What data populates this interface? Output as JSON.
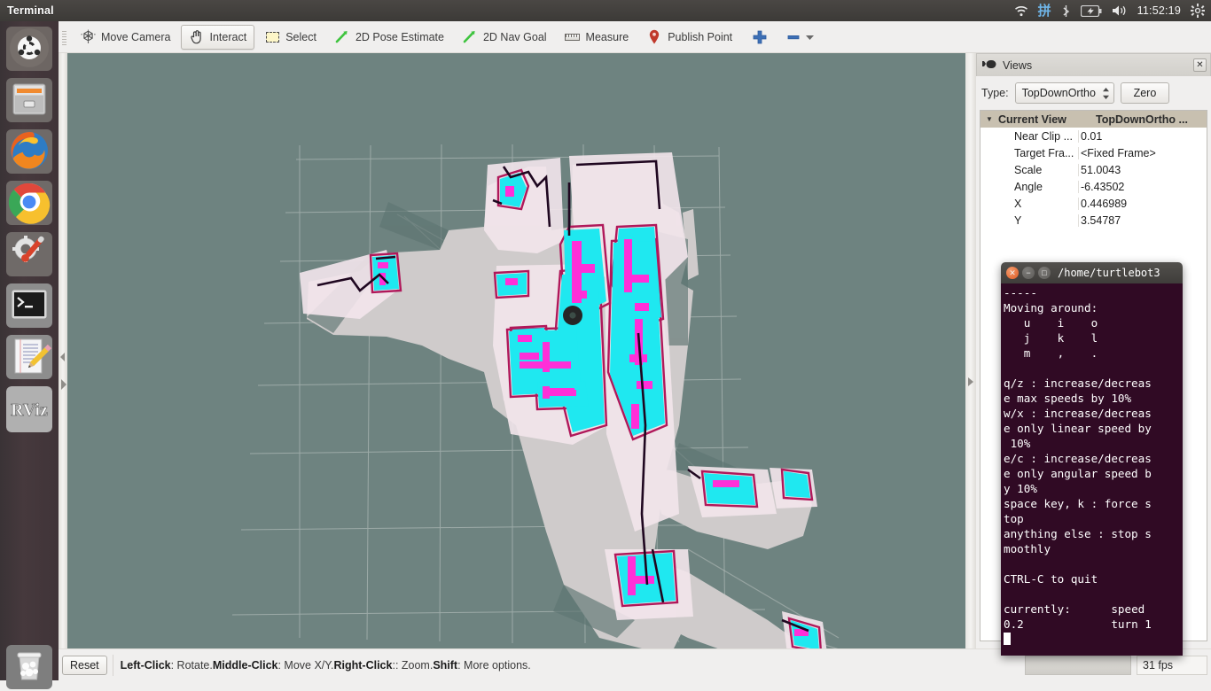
{
  "top_panel": {
    "app_title": "Terminal",
    "tray": {
      "wifi_icon": "wifi-icon",
      "ime_label": "拼",
      "bluetooth_icon": "bluetooth-icon",
      "battery_icon": "battery-icon",
      "volume_icon": "volume-icon",
      "clock": "11:52:19",
      "gear_icon": "gear-icon"
    }
  },
  "launcher": {
    "items": [
      {
        "name": "ubuntu-dash-icon",
        "label": "Ubuntu Dash"
      },
      {
        "name": "files-icon",
        "label": "Files"
      },
      {
        "name": "firefox-icon",
        "label": "Firefox"
      },
      {
        "name": "chrome-icon",
        "label": "Google Chrome"
      },
      {
        "name": "settings-icon",
        "label": "System Settings"
      },
      {
        "name": "terminal-icon",
        "label": "Terminal"
      },
      {
        "name": "text-editor-icon",
        "label": "Text Editor"
      },
      {
        "name": "rviz-icon",
        "label": "RViz"
      },
      {
        "name": "trash-icon",
        "label": "Trash"
      }
    ],
    "rviz_label": "RViz"
  },
  "toolbar": {
    "buttons": [
      {
        "label": "Move Camera",
        "icon": "move-camera-icon",
        "active": false
      },
      {
        "label": "Interact",
        "icon": "interact-hand-icon",
        "active": true
      },
      {
        "label": "Select",
        "icon": "select-icon",
        "active": false
      },
      {
        "label": "2D Pose Estimate",
        "icon": "pose-arrow-icon",
        "active": false
      },
      {
        "label": "2D Nav Goal",
        "icon": "nav-goal-arrow-icon",
        "active": false
      },
      {
        "label": "Measure",
        "icon": "ruler-icon",
        "active": false
      },
      {
        "label": "Publish Point",
        "icon": "map-pin-icon",
        "active": false
      }
    ],
    "add_tool_icon": "plus-icon",
    "remove_tool_icon": "minus-icon",
    "overflow_icon": "chevron-down-icon"
  },
  "views": {
    "title": "Views",
    "title_icon": "camera-icon",
    "close_icon": "close-icon",
    "type_label": "Type:",
    "type_value": "TopDownOrtho",
    "zero_button": "Zero",
    "tree": {
      "root_label": "Current View",
      "root_value": "TopDownOrtho ...",
      "rows": [
        {
          "name": "Near Clip ...",
          "value": "0.01"
        },
        {
          "name": "Target Fra...",
          "value": "<Fixed Frame>"
        },
        {
          "name": "Scale",
          "value": "51.0043"
        },
        {
          "name": "Angle",
          "value": "-6.43502"
        },
        {
          "name": "X",
          "value": "0.446989"
        },
        {
          "name": "Y",
          "value": "3.54787"
        }
      ]
    }
  },
  "statusbar": {
    "reset_label": "Reset",
    "hint_left_click_key": "Left-Click",
    "hint_left_click_val": ": Rotate. ",
    "hint_middle_click_key": "Middle-Click",
    "hint_middle_click_val": ": Move X/Y. ",
    "hint_right_click_key": "Right-Click",
    "hint_right_click_val": ":: Zoom. ",
    "hint_shift_key": "Shift",
    "hint_shift_val": ": More options.",
    "fps": "31 fps"
  },
  "terminal": {
    "title": "/home/turtlebot3",
    "close_icon": "window-close-icon",
    "minimize_icon": "window-minimize-icon",
    "maximize_icon": "window-maximize-icon",
    "content": "-----\nMoving around:\n   u    i    o\n   j    k    l\n   m    ,    .\n\nq/z : increase/decreas\ne max speeds by 10%\nw/x : increase/decreas\ne only linear speed by\n 10%\ne/c : increase/decreas\ne only angular speed b\ny 10%\nspace key, k : force s\ntop\nanything else : stop s\nmoothly\n\nCTRL-C to quit\n\ncurrently:\tspeed\n0.2\t\tturn 1\n"
  },
  "viewport": {
    "background_color": "#6e8380",
    "grid_color": "#c9cfcd",
    "map_free_color": "#cfcbcb",
    "map_unknown_color": "#6e8380",
    "costmap_inflation_color": "#1fe8f0",
    "costmap_lethal_color": "#ff2fd8",
    "costmap_border_color": "#b0185a",
    "robot_color": "#262626"
  }
}
